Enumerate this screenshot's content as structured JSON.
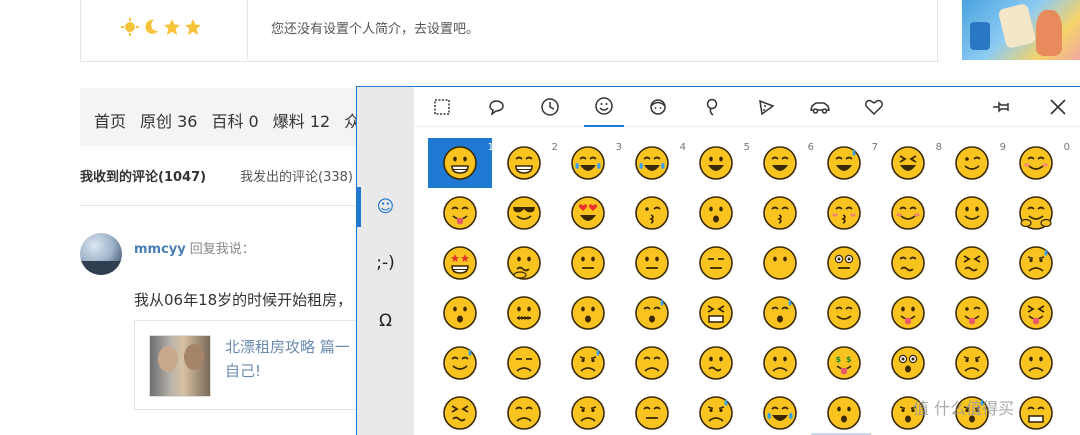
{
  "profile": {
    "bio_text": "您还没有设置个人简介，去设置吧。",
    "level_badges": [
      "sun-badge",
      "moon-badge",
      "star-badge",
      "star-badge"
    ]
  },
  "nav_tabs": {
    "items": [
      "首页",
      "原创 36",
      "百科 0",
      "爆料 12",
      "众"
    ]
  },
  "comment_tabs": {
    "received": "我收到的评论(1047)",
    "sent": "我发出的评论(338)"
  },
  "comment": {
    "username": "mmcyy",
    "action": "回复我说：",
    "text": "我从06年18岁的时候开始租房，",
    "quote_title_line1": "北漂租房攻略 篇一",
    "quote_title_line2": "自己!"
  },
  "emoji_panel": {
    "side_tabs": [
      {
        "label": "☺",
        "name": "emoji-tab"
      },
      {
        "label": ";-)",
        "name": "kaomoji-tab"
      },
      {
        "label": "Ω",
        "name": "symbols-tab"
      }
    ],
    "category_icons": [
      "gif-icon",
      "search-bubble-icon",
      "recent-clock-icon",
      "smiley-icon",
      "people-icon",
      "celebration-icon",
      "food-icon",
      "travel-car-icon",
      "heart-icon"
    ],
    "pin_icon": "pin-icon",
    "close_icon": "close-icon",
    "selected_index": 0,
    "shortcut_numbers": [
      "1",
      "2",
      "3",
      "4",
      "5",
      "6",
      "7",
      "8",
      "9",
      "0"
    ],
    "emojis": [
      "grinning",
      "beaming",
      "joy",
      "rofl",
      "smiley",
      "smile",
      "sweat-smile",
      "laughing",
      "wink",
      "blush",
      "yum",
      "cool",
      "heart-eyes",
      "kiss-heart",
      "kissing",
      "kiss-closed",
      "kiss-smiling",
      "relieved",
      "slight-smile",
      "hug",
      "star-struck",
      "thinking",
      "raised-eyebrow",
      "neutral",
      "expressionless",
      "no-mouth",
      "eye-roll",
      "smirk",
      "persevere",
      "disappointed-relieved",
      "open-mouth",
      "zipper",
      "hushed",
      "sleepy",
      "tired",
      "sleeping",
      "relieved2",
      "tongue",
      "wink-tongue",
      "squint-tongue",
      "drool",
      "unamused",
      "sweat",
      "pensive",
      "confused",
      "upside-down",
      "money",
      "astonished",
      "frowning",
      "slight-frown",
      "confounded",
      "disappointed",
      "worried",
      "triumph",
      "cry",
      "sob",
      "frown-open",
      "anguished",
      "fearful",
      "weary"
    ],
    "watermark": "值 什么值得买"
  },
  "colors": {
    "accent": "#1f78d1",
    "emoji_face": "#f9c41f",
    "emoji_outline": "#3b2a00",
    "link": "#4a7fb5"
  }
}
